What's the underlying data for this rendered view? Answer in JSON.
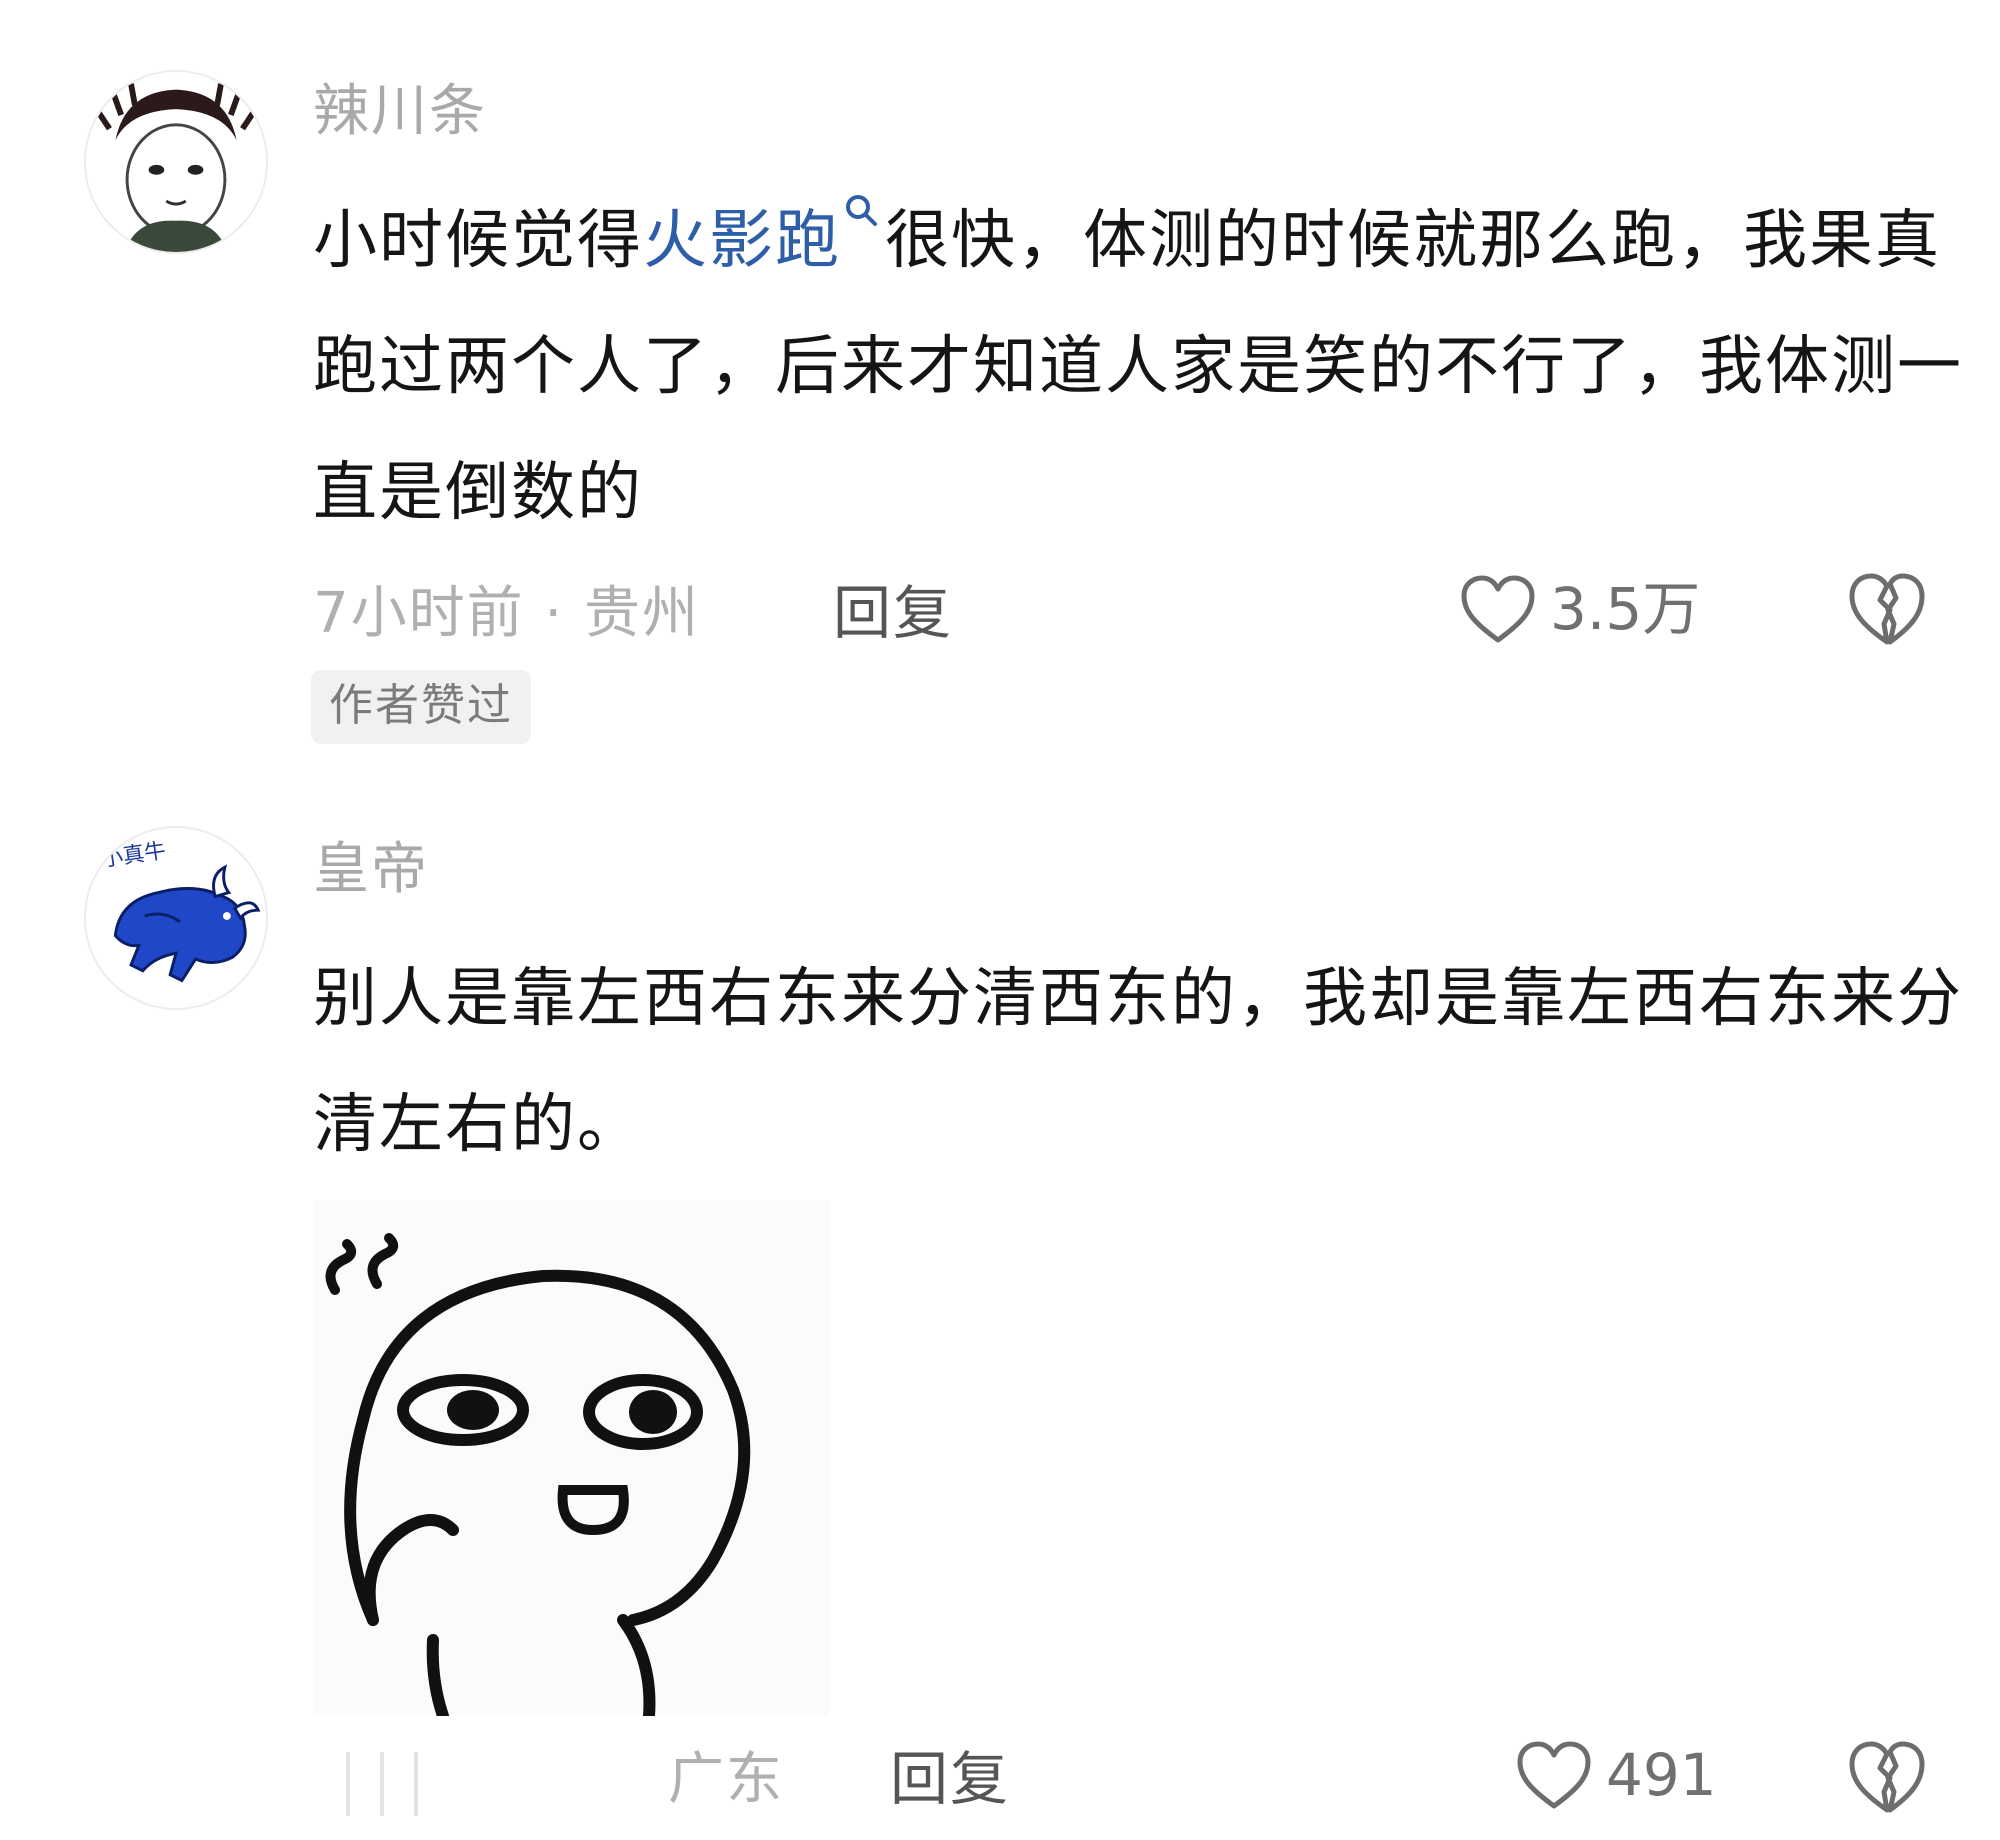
{
  "comments": [
    {
      "username": "辣川条",
      "text_before": "小时候觉得",
      "highlight": "火影跑",
      "text_after": "很快，体测的时候就那么跑，我果真跑过两个人了，后来才知道人家是笑的不行了，我体测一直是倒数的",
      "time_location": "7小时前 · 贵州",
      "reply_label": "回复",
      "like_count": "3.5万",
      "badge": "作者赞过",
      "avatar_icon": "cartoon-girl-avatar-icon"
    },
    {
      "username": "皇帝",
      "text": "别人是靠左西右东来分清西东的，我却是靠左西右东来分清左右的。",
      "location": "广东",
      "reply_label": "回复",
      "like_count": "491",
      "avatar_icon": "blue-bull-avatar-icon",
      "avatar_text": "小真牛",
      "sticker_icon": "doodle-face-sticker-icon"
    }
  ],
  "colors": {
    "highlight": "#2f5ea8",
    "muted": "#a9a9a9",
    "text": "#151515"
  }
}
